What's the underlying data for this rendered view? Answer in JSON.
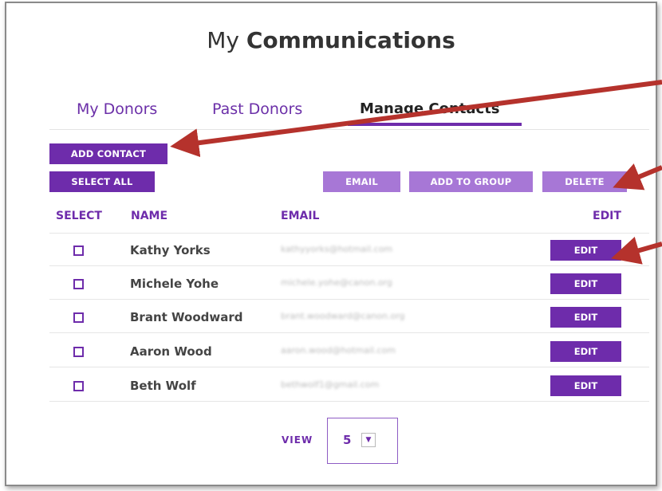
{
  "title": {
    "prefix": "My",
    "bold": "Communications"
  },
  "tabs": [
    {
      "label": "My Donors",
      "active": false
    },
    {
      "label": "Past Donors",
      "active": false
    },
    {
      "label": "Manage Contacts",
      "active": true
    }
  ],
  "actions": {
    "add_contact": "ADD CONTACT",
    "select_all": "SELECT ALL",
    "email": "EMAIL",
    "add_to_group": "ADD TO GROUP",
    "delete": "DELETE"
  },
  "table": {
    "columns": [
      "SELECT",
      "NAME",
      "EMAIL",
      "EDIT"
    ],
    "rows": [
      {
        "name": "Kathy Yorks",
        "email": "kathyyorks@hotmail.com",
        "edit_label": "EDIT"
      },
      {
        "name": "Michele Yohe",
        "email": "michele.yohe@canon.org",
        "edit_label": "EDIT"
      },
      {
        "name": "Brant Woodward",
        "email": "brant.woodward@canon.org",
        "edit_label": "EDIT"
      },
      {
        "name": "Aaron Wood",
        "email": "aaron.wood@hotmail.com",
        "edit_label": "EDIT"
      },
      {
        "name": "Beth Wolf",
        "email": "bethwolf1@gmail.com",
        "edit_label": "EDIT"
      }
    ]
  },
  "pagination": {
    "view_label": "VIEW",
    "view_value": "5",
    "dropdown_icon": "▼"
  },
  "colors": {
    "accent": "#6e2cab",
    "accent_light": "#a777d6",
    "arrow": "#b5322c"
  },
  "icons": [
    "checkbox-icon",
    "dropdown-arrow-icon",
    "annotation-arrow-icon"
  ]
}
